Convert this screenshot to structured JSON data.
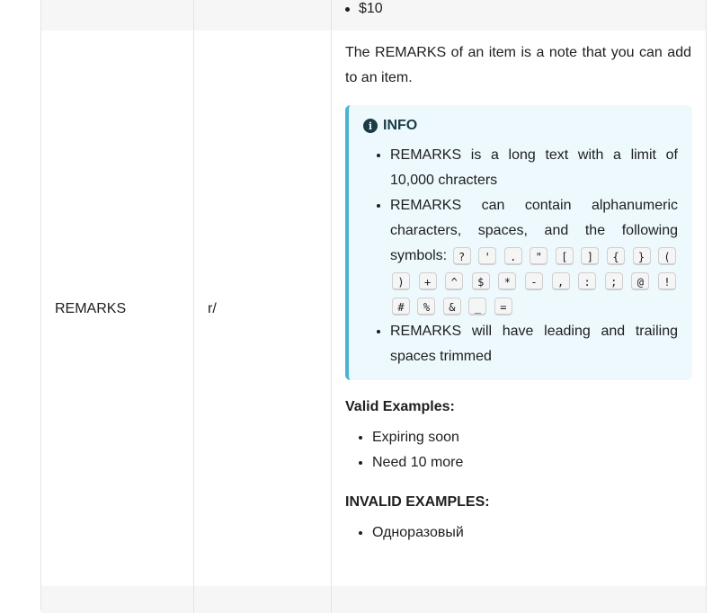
{
  "top_row": {
    "bullet": "$10"
  },
  "field": {
    "name": "REMARKS",
    "prefix": "r/",
    "description": "The REMARKS of an item is a note that you can add to an item.",
    "info": {
      "title": "INFO",
      "bullet1": "REMARKS is a long text with a limit of 10,000 chracters",
      "bullet2_text": "REMARKS can contain alphanumeric characters, spaces, and the following symbols:",
      "symbols": [
        "?",
        "'",
        ".",
        "\"",
        "[",
        "]",
        "{",
        "}",
        "(",
        ")",
        "+",
        "^",
        "$",
        "*",
        "-",
        ",",
        ":",
        ";",
        "@",
        "!",
        "#",
        "%",
        "&",
        "_",
        "="
      ],
      "bullet3": "REMARKS will have leading and trailing spaces trimmed"
    },
    "valid_title": "Valid Examples:",
    "valid_examples": [
      "Expiring soon",
      "Need 10 more"
    ],
    "invalid_title": "INVALID EXAMPLES:",
    "invalid_examples": [
      "Одноразовый"
    ]
  }
}
